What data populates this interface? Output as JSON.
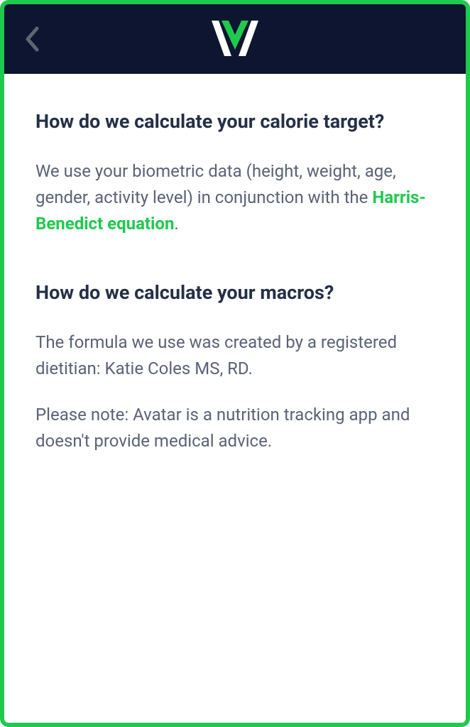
{
  "sections": {
    "calorie": {
      "heading": "How do we calculate your calorie target?",
      "body_prefix": "We use your biometric data (height, weight, age, gender, activity level) in conjunction with the ",
      "link_text": "Harris-Benedict equation",
      "body_suffix": "."
    },
    "macros": {
      "heading": "How do we calculate your macros?",
      "p1": "The formula we use was created by a registered dietitian: Katie Coles MS, RD.",
      "p2": "Please note: Avatar is a nutrition tracking app and doesn't provide medical advice."
    }
  }
}
